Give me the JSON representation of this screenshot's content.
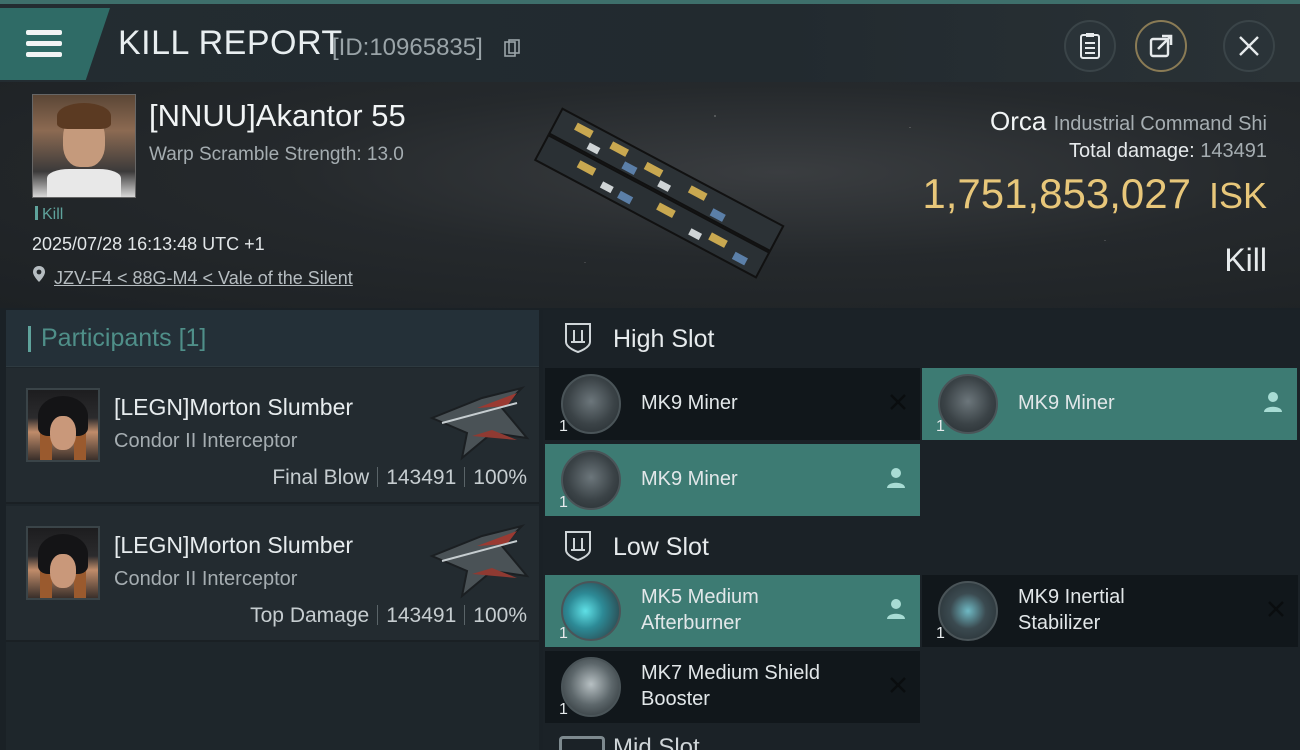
{
  "header": {
    "title": "KILL REPORT",
    "report_id": "[ID:10965835]"
  },
  "victim": {
    "name": "[NNUU]Akantor 55",
    "warp_scramble": "Warp Scramble Strength: 13.0",
    "tag": "Kill",
    "datetime": "2025/07/28 16:13:48 UTC +1",
    "location": "JZV-F4 < 88G-M4 < Vale of the Silent",
    "ship_name": "Orca",
    "ship_class": "Industrial Command Shi",
    "total_damage_label": "Total damage:",
    "total_damage": "143491",
    "isk_value": "1,751,853,027",
    "isk_unit": "ISK",
    "result": "Kill"
  },
  "participants": {
    "title": "Participants",
    "count": "[1]",
    "rows": [
      {
        "name": "[LEGN]Morton Slumber",
        "ship": "Condor II Interceptor",
        "role": "Final Blow",
        "damage": "143491",
        "percent": "100%"
      },
      {
        "name": "[LEGN]Morton Slumber",
        "ship": "Condor II Interceptor",
        "role": "Top Damage",
        "damage": "143491",
        "percent": "100%"
      }
    ]
  },
  "fitting": {
    "high_slot_label": "High Slot",
    "low_slot_label": "Low Slot",
    "mid_slot_label": "Mid Slot",
    "high": [
      {
        "name": "MK9 Miner",
        "qty": "1",
        "state": "destroyed"
      },
      {
        "name": "MK9 Miner",
        "qty": "1",
        "state": "dropped"
      },
      {
        "name": "MK9 Miner",
        "qty": "1",
        "state": "dropped"
      }
    ],
    "low": [
      {
        "name": "MK5 Medium Afterburner",
        "qty": "1",
        "state": "dropped"
      },
      {
        "name": "MK9 Inertial Stabilizer",
        "qty": "1",
        "state": "destroyed"
      },
      {
        "name": "MK7 Medium Shield Booster",
        "qty": "1",
        "state": "destroyed"
      }
    ]
  },
  "colors": {
    "accent_teal": "#3d7b73",
    "isk_gold": "#e8c77a",
    "menu_tab": "#2f6b66"
  },
  "icons": [
    "menu-icon",
    "copy-icon",
    "clipboard-icon",
    "share-icon",
    "close-icon",
    "location-pin-icon",
    "slot-shield-icon",
    "user-icon",
    "destroyed-x-icon"
  ]
}
